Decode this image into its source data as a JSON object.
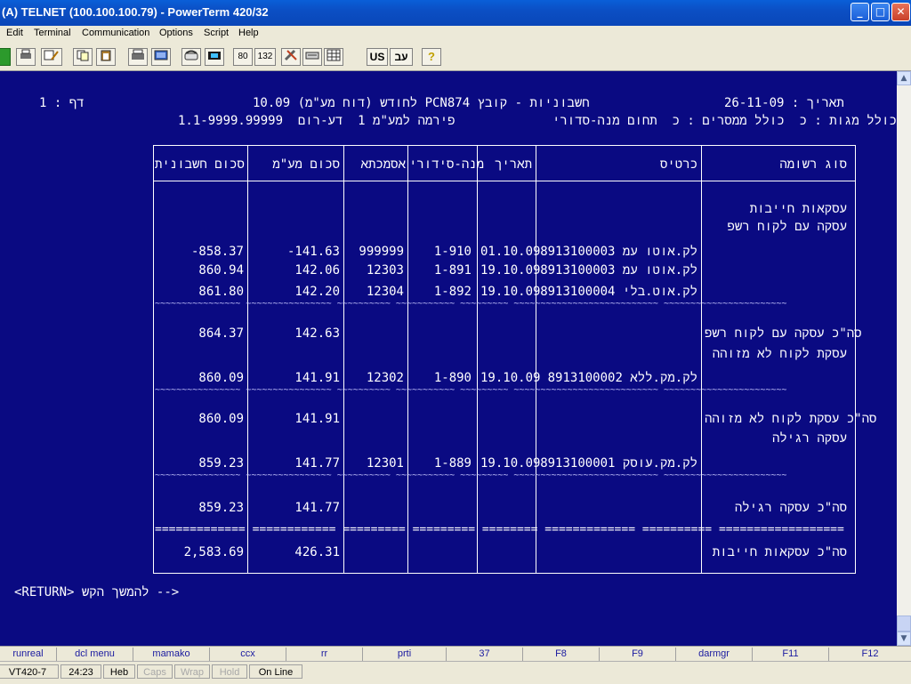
{
  "window": {
    "title": "(A) TELNET (100.100.100.79) - PowerTerm 420/32",
    "minimize": "_",
    "maximize": "□",
    "close": "✕"
  },
  "menu": [
    "Edit",
    "Terminal",
    "Communication",
    "Options",
    "Script",
    "Help"
  ],
  "toolbar": {
    "cols80": "80",
    "cols132": "132",
    "us": "US",
    "heb": "עב",
    "help": "?"
  },
  "terminal": {
    "page_label": "1 : דף",
    "header_line1": "10.09 לחודש (דוח מע\"מ) PCN874 חשבוניות - קובץ",
    "header_line1_date": "26-11-09 : תאריך",
    "header_line2": "פירמה למע\"מ 1  דע-רום  1.1-9999.99999",
    "header_line2_right": "כולל מגות : כ  כולל ממסרים : כ  תחום מנה-סדורי",
    "columns": [
      "סוג רשומה",
      "כרטיס",
      "תאריך",
      "מנה-סידורי",
      "אסמכתא",
      "סכום מע\"מ",
      "סכום חשבונית"
    ],
    "section1_title": "עסקאות חייבות",
    "section1_sub": "עסקה עם לקוח רשפ",
    "rows_a": [
      {
        "card": "8913100003 לק.אוטו עמ",
        "date": "01.10.09",
        "batch": "1-910",
        "ref": "999999",
        "vat": "-141.63",
        "invoice": "-858.37"
      },
      {
        "card": "8913100003 לק.אוטו עמ",
        "date": "19.10.09",
        "batch": "1-891",
        "ref": "12303",
        "vat": "142.06",
        "invoice": "860.94"
      },
      {
        "card": "8913100004 לק.אוט.בלי",
        "date": "19.10.09",
        "batch": "1-892",
        "ref": "12304",
        "vat": "142.20",
        "invoice": "861.80"
      }
    ],
    "subtotal_a_label": "סה\"כ עסקה עם לקוח רשפ",
    "subtotal_a_vat": "142.63",
    "subtotal_a_invoice": "864.37",
    "section_b_title": "עסקת לקוח לא מזוהה",
    "row_b": {
      "card": "8913100002 לק.מק.ללא",
      "date": "19.10.09",
      "batch": "1-890",
      "ref": "12302",
      "vat": "141.91",
      "invoice": "860.09"
    },
    "subtotal_b_label": "סה\"כ עסקת לקוח לא מזוהה",
    "subtotal_b_vat": "141.91",
    "subtotal_b_invoice": "860.09",
    "section_c_title": "עסקה רגילה",
    "row_c": {
      "card": "8913100001 לק.מק.עוסק",
      "date": "19.10.09",
      "batch": "1-889",
      "ref": "12301",
      "vat": "141.77",
      "invoice": "859.23"
    },
    "subtotal_c_label": "סה\"כ עסקה רגילה",
    "subtotal_c_vat": "141.77",
    "subtotal_c_invoice": "859.23",
    "total_label": "סה\"כ עסקאות חייבות",
    "total_vat": "426.31",
    "total_invoice": "2,583.69",
    "prompt": "<RETURN> להמשך הקש -->"
  },
  "fkeys": [
    "runreal",
    "dcl menu",
    "mamako",
    "ccx",
    "rr",
    "prti",
    "37",
    "F8",
    "F9",
    "darmgr",
    "F11",
    "F12"
  ],
  "status": {
    "terminal": "VT420-7",
    "cursor": "24:23",
    "lang": "Heb",
    "caps": "Caps",
    "wrap": "Wrap",
    "hold": "Hold",
    "online": "On Line"
  },
  "colors": {
    "screen_bg": "#0a0a82",
    "text": "#ffffff",
    "titlebar": "#0b4fc4"
  }
}
